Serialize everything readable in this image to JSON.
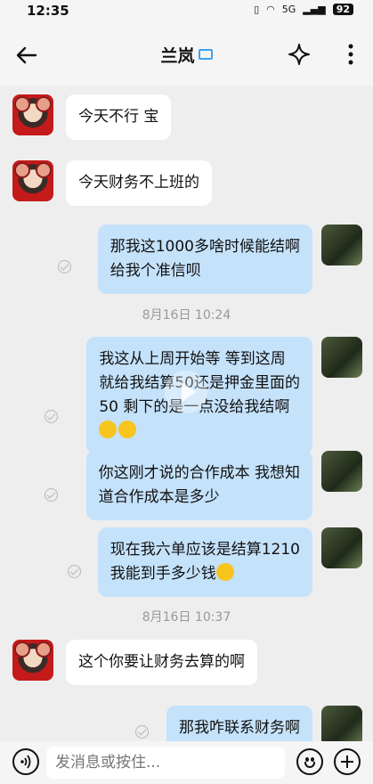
{
  "status_bar": {
    "time": "12:35",
    "network": "5G",
    "battery": "92"
  },
  "header": {
    "title": "兰岚"
  },
  "messages": [
    {
      "side": "in",
      "lines": [
        "今天不行 宝"
      ]
    },
    {
      "side": "in",
      "lines": [
        "今天财务不上班的"
      ]
    },
    {
      "side": "out",
      "lines": [
        "那我这1000多啥时候能结啊",
        "给我个准信呗"
      ]
    },
    {
      "side": "time",
      "text": "8月16日  10:24"
    },
    {
      "side": "out",
      "lines": [
        "我这从上周开始等  等到这周",
        "就给我结算50还是押金里面的",
        "50  剩下的是一点没给我结啊"
      ]
    },
    {
      "side": "out",
      "lines": [
        "你这刚才说的合作成本  我想知",
        "道合作成本是多少"
      ]
    },
    {
      "side": "out",
      "lines": [
        "现在我六单应该是结算1210",
        "我能到手多少钱"
      ]
    },
    {
      "side": "time",
      "text": "8月16日  10:37"
    },
    {
      "side": "in",
      "lines": [
        "这个你要让财务去算的啊"
      ]
    },
    {
      "side": "out",
      "lines": [
        "那我咋联系财务啊"
      ]
    }
  ],
  "input": {
    "placeholder": "发消息或按住..."
  },
  "colors": {
    "incoming_bubble": "#ffffff",
    "outgoing_bubble": "#c5e2fb",
    "background": "#eeeeee"
  }
}
